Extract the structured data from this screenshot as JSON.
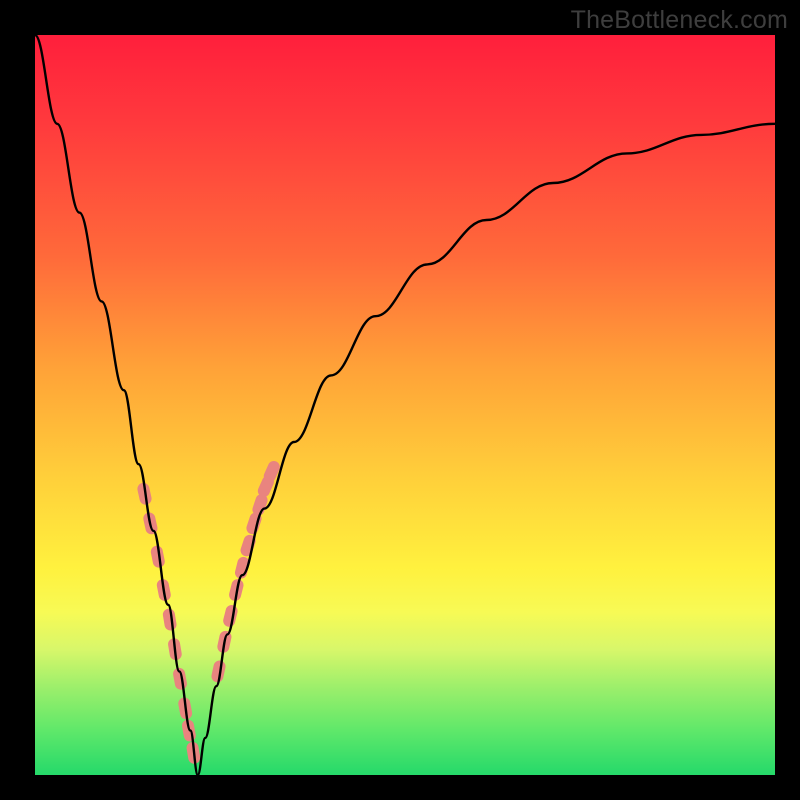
{
  "watermark": "TheBottleneck.com",
  "chart_data": {
    "type": "line",
    "title": "",
    "xlabel": "",
    "ylabel": "",
    "xlim": [
      0,
      100
    ],
    "ylim": [
      0,
      100
    ],
    "notch_x": 22,
    "series": [
      {
        "name": "bottleneck-curve",
        "x": [
          0,
          3,
          6,
          9,
          12,
          14,
          16,
          18,
          19.5,
          21,
          22,
          23,
          24.5,
          26,
          28,
          31,
          35,
          40,
          46,
          53,
          61,
          70,
          80,
          90,
          100
        ],
        "values": [
          100,
          88,
          76,
          64,
          52,
          42,
          33,
          23,
          14,
          6,
          0,
          5,
          12,
          19,
          27,
          36,
          45,
          54,
          62,
          69,
          75,
          80,
          84,
          86.5,
          88
        ]
      }
    ],
    "highlight_points": {
      "name": "highlight-region",
      "color": "#e9847f",
      "x": [
        14.8,
        15.6,
        16.6,
        17.4,
        18.2,
        18.9,
        19.6,
        20.3,
        20.8,
        21.4,
        24.8,
        25.6,
        26.4,
        27.2,
        28.0,
        28.8,
        29.6,
        30.4,
        31.2,
        32.0
      ],
      "values": [
        38,
        34,
        29.5,
        25,
        21,
        17,
        13,
        9,
        6,
        3,
        14,
        18,
        21.5,
        25,
        28,
        31,
        34,
        36.5,
        39,
        41
      ]
    }
  }
}
